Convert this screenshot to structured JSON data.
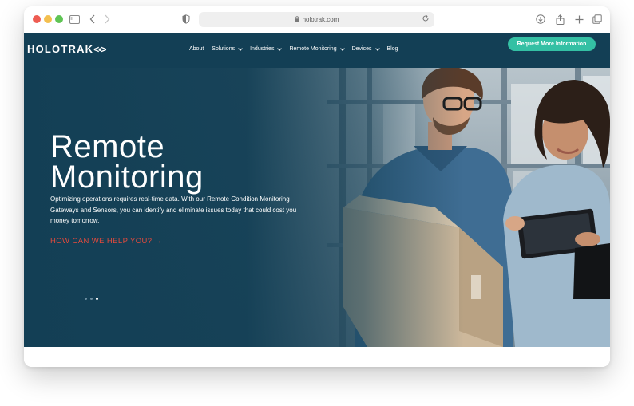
{
  "browser": {
    "url": "holotrak.com"
  },
  "header": {
    "logo_text": "HOLOTRAK",
    "logo_mark": "<•>",
    "nav_items": [
      {
        "label": "About",
        "has_dropdown": false
      },
      {
        "label": "Solutions",
        "has_dropdown": true
      },
      {
        "label": "Industries",
        "has_dropdown": true
      },
      {
        "label": "Remote Monitoring",
        "has_dropdown": true
      },
      {
        "label": "Devices",
        "has_dropdown": true
      },
      {
        "label": "Blog",
        "has_dropdown": false
      }
    ],
    "cta_label": "Request More Information"
  },
  "hero": {
    "title_line1": "Remote",
    "title_line2": "Monitoring",
    "description": "Optimizing operations requires real-time data. With our Remote Condition Monitoring Gateways and Sensors, you can identify and eliminate issues today that could cost you money tomorrow.",
    "link_label": "HOW CAN WE HELP YOU? →",
    "slider": {
      "count": 3,
      "active_index": 2
    }
  },
  "colors": {
    "brand_dark": "#133f55",
    "accent_teal": "#34c0a4",
    "link_red": "#e34a3d"
  },
  "icons": [
    "sidebar-toggle-icon",
    "back-icon",
    "forward-icon",
    "shield-icon",
    "lock-icon",
    "reload-icon",
    "download-icon",
    "share-icon",
    "new-tab-icon",
    "tabs-icon"
  ]
}
